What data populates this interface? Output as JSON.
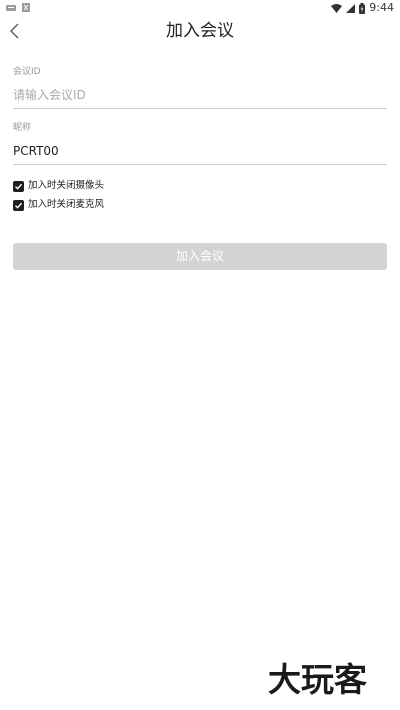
{
  "status_bar": {
    "time": "9:44",
    "icons": [
      "notification-icon",
      "download-icon",
      "wifi-icon",
      "signal-icon",
      "battery-icon"
    ]
  },
  "header": {
    "title": "加入会议",
    "back_icon": "chevron-left-icon"
  },
  "form": {
    "meeting_id": {
      "label": "会议ID",
      "placeholder": "请输入会议ID",
      "value": ""
    },
    "nickname": {
      "label": "昵称",
      "value": "PCRT00"
    },
    "options": [
      {
        "label": "加入时关闭摄像头",
        "checked": true
      },
      {
        "label": "加入时关闭麦克风",
        "checked": true
      }
    ],
    "join_button_label": "加入会议"
  },
  "watermark": "大玩客",
  "colors": {
    "background": "#ffffff",
    "button_disabled": "#d3d3d3",
    "checkbox": "#1f1f1f",
    "label_gray": "#999999"
  }
}
